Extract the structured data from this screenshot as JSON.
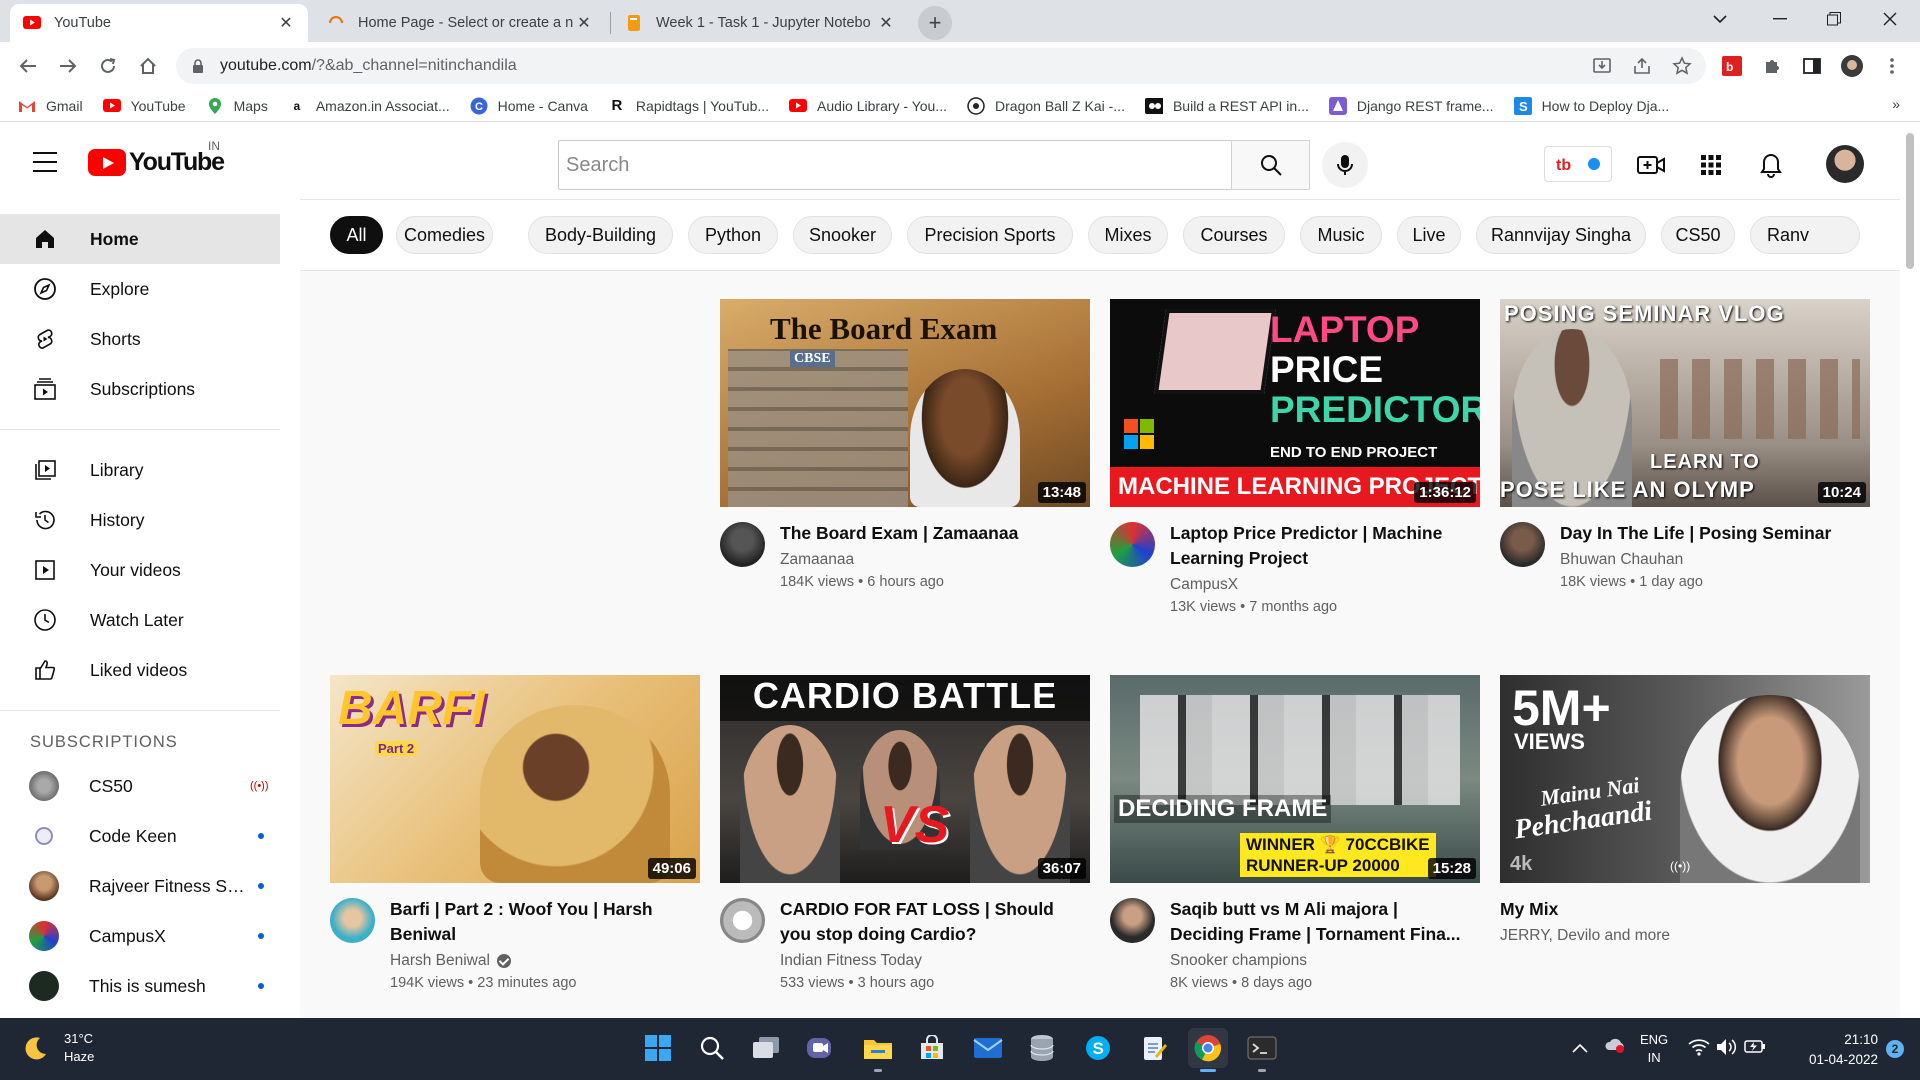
{
  "browser": {
    "tabs": [
      {
        "title": "YouTube",
        "close": "✕"
      },
      {
        "title": "Home Page - Select or create a n",
        "close": "✕"
      },
      {
        "title": "Week 1 - Task 1 - Jupyter Notebo",
        "close": "✕"
      }
    ],
    "new_tab": "+",
    "url_main": "youtube.com",
    "url_rest": "/?&ab_channel=nitinchandila",
    "bookmarks": [
      {
        "label": "Gmail",
        "icon": "gmail-icon"
      },
      {
        "label": "YouTube",
        "icon": "youtube-icon"
      },
      {
        "label": "Maps",
        "icon": "maps-icon"
      },
      {
        "label": "Amazon.in Associat...",
        "icon": "amazon-icon"
      },
      {
        "label": "Home - Canva",
        "icon": "canva-icon"
      },
      {
        "label": "Rapidtags | YouTub...",
        "icon": "rapidtags-icon"
      },
      {
        "label": "Audio Library - You...",
        "icon": "youtube-icon"
      },
      {
        "label": "Dragon Ball Z Kai -...",
        "icon": "dragonball-icon"
      },
      {
        "label": "Build a REST API in...",
        "icon": "video-icon"
      },
      {
        "label": "Django REST frame...",
        "icon": "django-icon"
      },
      {
        "label": "How to Deploy Dja...",
        "icon": "s-icon"
      }
    ],
    "more_bookmarks": "»"
  },
  "youtube": {
    "logo_text": "YouTube",
    "country_code": "IN",
    "search_placeholder": "Search",
    "sidebar": {
      "main": [
        {
          "label": "Home",
          "icon": "home-icon",
          "active": true
        },
        {
          "label": "Explore",
          "icon": "compass-icon"
        },
        {
          "label": "Shorts",
          "icon": "shorts-icon"
        },
        {
          "label": "Subscriptions",
          "icon": "subscriptions-icon"
        }
      ],
      "library": [
        {
          "label": "Library",
          "icon": "library-icon"
        },
        {
          "label": "History",
          "icon": "history-icon"
        },
        {
          "label": "Your videos",
          "icon": "your-videos-icon"
        },
        {
          "label": "Watch Later",
          "icon": "clock-icon"
        },
        {
          "label": "Liked videos",
          "icon": "thumbs-up-icon"
        }
      ],
      "subscriptions_heading": "SUBSCRIPTIONS",
      "subscriptions": [
        {
          "name": "CS50",
          "status": "live",
          "color": "#7a7a7a"
        },
        {
          "name": "Code Keen",
          "status": "dot",
          "color": "#b8b8d8"
        },
        {
          "name": "Rajveer Fitness Se...",
          "status": "dot",
          "color": "#8a5a3a"
        },
        {
          "name": "CampusX",
          "status": "dot",
          "color": "#3050c0"
        },
        {
          "name": "This is sumesh",
          "status": "dot",
          "color": "#1d2a22"
        }
      ]
    },
    "chips": [
      "All",
      "Comedies",
      "Body-Building",
      "Python",
      "Snooker",
      "Precision Sports",
      "Mixes",
      "Courses",
      "Music",
      "Live",
      "Rannvijay Singha",
      "CS50",
      "Ranv"
    ],
    "videos_row1": [
      {
        "title": "The Board Exam | Zamaanaa",
        "channel": "Zamaanaa",
        "views": "184K views",
        "age": "6 hours ago",
        "duration": "13:48",
        "verified": false,
        "thumb_text": [
          "The Board Exam",
          "CBSE"
        ]
      },
      {
        "title": "Laptop Price Predictor | Machine Learning Project",
        "channel": "CampusX",
        "views": "13K views",
        "age": "7 months ago",
        "duration": "1:36:12",
        "verified": false,
        "thumb_text": [
          "LAPTOP",
          "PRICE",
          "PREDICTOR",
          "END TO END PROJECT",
          "MACHINE LEARNING PROJECTS"
        ]
      },
      {
        "title": "Day In The Life | Posing Seminar",
        "channel": "Bhuwan Chauhan",
        "views": "18K views",
        "age": "1 day ago",
        "duration": "10:24",
        "verified": false,
        "thumb_text": [
          "POSING SEMINAR VLOG",
          "LEARN TO",
          "POSE LIKE AN OLYMP"
        ]
      }
    ],
    "videos_row2": [
      {
        "title": "Barfi | Part 2 : Woof You | Harsh Beniwal",
        "channel": "Harsh Beniwal",
        "views": "194K views",
        "age": "23 minutes ago",
        "duration": "49:06",
        "verified": true,
        "thumb_text": [
          "BARFI",
          "Part 2"
        ]
      },
      {
        "title": "CARDIO FOR FAT LOSS | Should you stop doing Cardio?",
        "channel": "Indian Fitness Today",
        "views": "533 views",
        "age": "3 hours ago",
        "duration": "36:07",
        "verified": false,
        "thumb_text": [
          "CARDIO BATTLE",
          "VS"
        ]
      },
      {
        "title": "Saqib butt vs M Ali majora | Deciding Frame | Tornament Fina...",
        "channel": "Snooker champions",
        "views": "8K views",
        "age": "8 days ago",
        "duration": "15:28",
        "verified": false,
        "thumb_text": [
          "DECIDING FRAME",
          "WINNER 🏆 70CCBIKE",
          "RUNNER-UP 20000"
        ]
      },
      {
        "title": "My Mix",
        "channel": "JERRY, Devilo and more",
        "views": "",
        "age": "",
        "duration": "",
        "verified": false,
        "thumb_text": [
          "5M+",
          "VIEWS",
          "Mainu Nai",
          "Pehchaandi",
          "4k"
        ]
      }
    ]
  },
  "taskbar": {
    "weather_temp": "31°C",
    "weather_desc": "Haze",
    "lang1": "ENG",
    "lang2": "IN",
    "time": "21:10",
    "date": "01-04-2022",
    "notif_count": "2"
  },
  "colors": {
    "yt_red": "#ff0000",
    "chip_active": "#0f0f0f",
    "taskbar": "#202734",
    "link_blue": "#065fd4"
  }
}
